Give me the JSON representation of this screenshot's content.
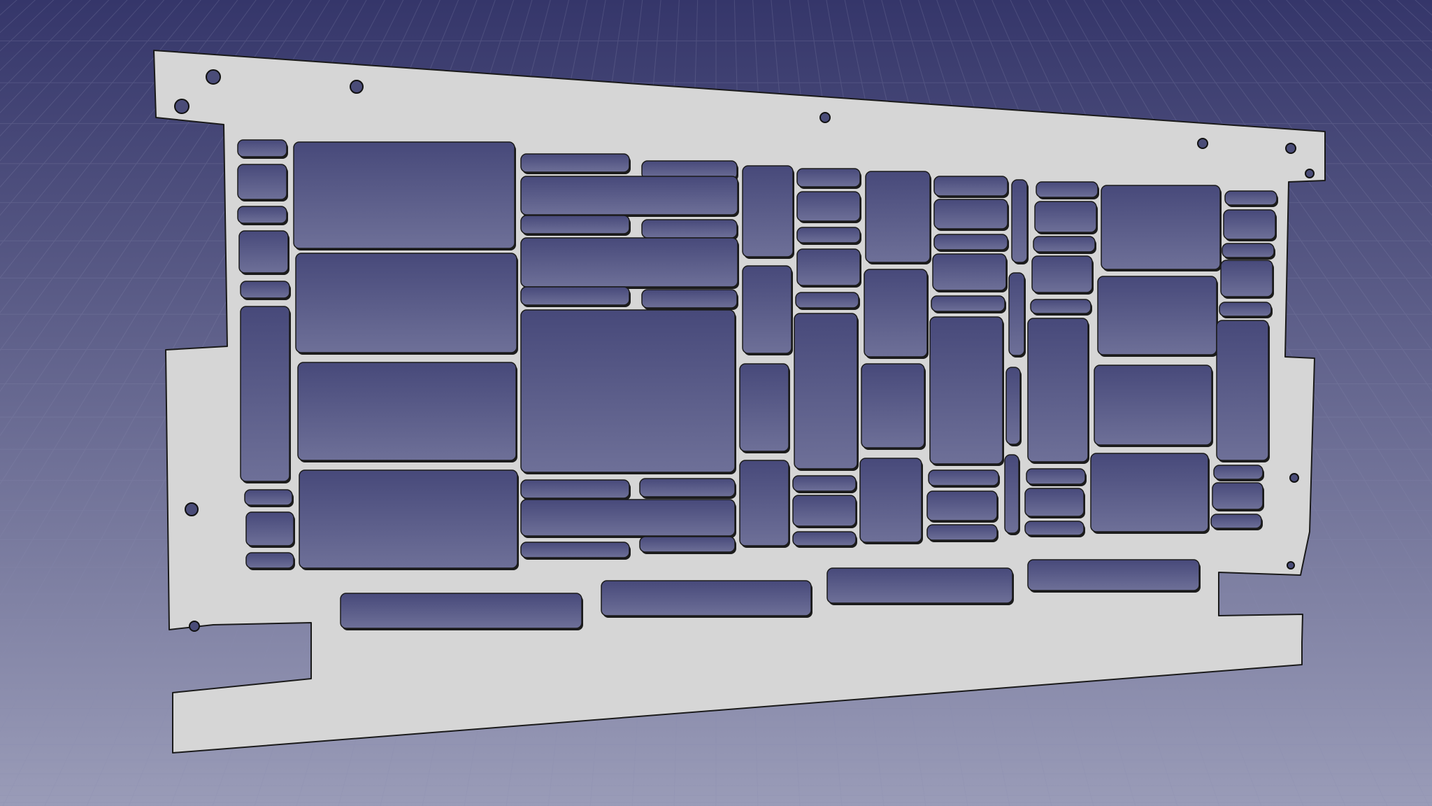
{
  "viewport": {
    "background_top": "#35366a",
    "background_bottom": "#9a9cb8",
    "grid_color": "#8a8cb0"
  },
  "part": {
    "face_color": "#d6d6d6",
    "edge_color": "#1a1a1a",
    "cutout_color": "#55577f"
  }
}
